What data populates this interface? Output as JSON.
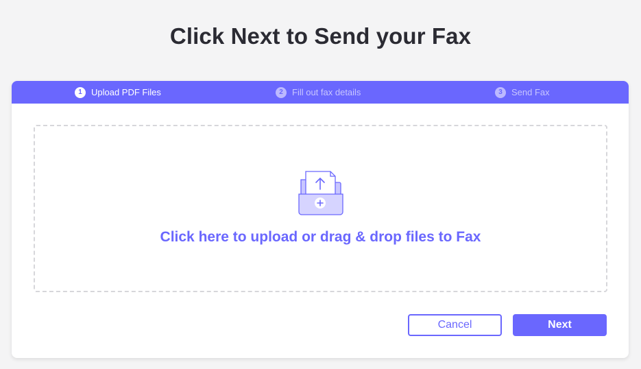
{
  "page": {
    "title": "Click Next to Send your Fax"
  },
  "steps": [
    {
      "number": "1",
      "label": "Upload PDF Files",
      "state": "active"
    },
    {
      "number": "2",
      "label": "Fill out fax details",
      "state": "inactive"
    },
    {
      "number": "3",
      "label": "Send Fax",
      "state": "inactive"
    }
  ],
  "dropzone": {
    "icon": "upload-folder-icon",
    "text": "Click here to upload or drag & drop files to Fax"
  },
  "actions": {
    "cancel_label": "Cancel",
    "next_label": "Next"
  },
  "colors": {
    "accent": "#6a67fe",
    "background": "#f4f4f5",
    "title": "#2b2b33"
  }
}
